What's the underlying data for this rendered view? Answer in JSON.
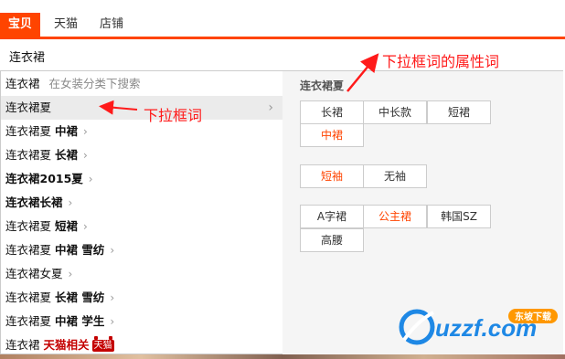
{
  "tabs": [
    {
      "label": "宝贝",
      "active": true
    },
    {
      "label": "天猫",
      "active": false
    },
    {
      "label": "店铺",
      "active": false
    }
  ],
  "search": {
    "value": "连衣裙"
  },
  "suggestions": {
    "first": {
      "text": "连衣裙",
      "hint": "在女装分类下搜索"
    },
    "items": [
      {
        "prefix": "连衣裙夏",
        "extra": ""
      },
      {
        "prefix": "连衣裙夏",
        "extra": "中裙"
      },
      {
        "prefix": "连衣裙夏",
        "extra": "长裙"
      },
      {
        "prefix": "连衣裙2015夏",
        "extra": ""
      },
      {
        "prefix": "连衣裙长裙",
        "extra": ""
      },
      {
        "prefix": "连衣裙夏",
        "extra": "短裙"
      },
      {
        "prefix": "连衣裙夏",
        "extra": "中裙 雪纺"
      },
      {
        "prefix": "连衣裙女夏",
        "extra": ""
      },
      {
        "prefix": "连衣裙夏",
        "extra": "长裙 雪纺"
      },
      {
        "prefix": "连衣裙夏",
        "extra": "中裙 学生"
      }
    ],
    "tmall": {
      "text": "连衣裙",
      "related": "天猫相关",
      "badge": "天猫"
    },
    "chevron": "›"
  },
  "attributes": {
    "title": "连衣裙夏",
    "group1": [
      "长裙",
      "中长款",
      "短裙",
      "中裙"
    ],
    "group2": [
      "短袖",
      "无袖"
    ],
    "group3": [
      "A字裙",
      "公主裙",
      "韩国SZ",
      "高腰"
    ]
  },
  "annotations": {
    "dropdown_label": "下拉框词",
    "attr_label": "下拉框词的属性词"
  },
  "watermark": {
    "brand": "uzzf.com",
    "tag": "东坡下载"
  },
  "colors": {
    "accent": "#ff4400",
    "annotation": "#ff1a1a",
    "orange_text": "#ff4400"
  }
}
